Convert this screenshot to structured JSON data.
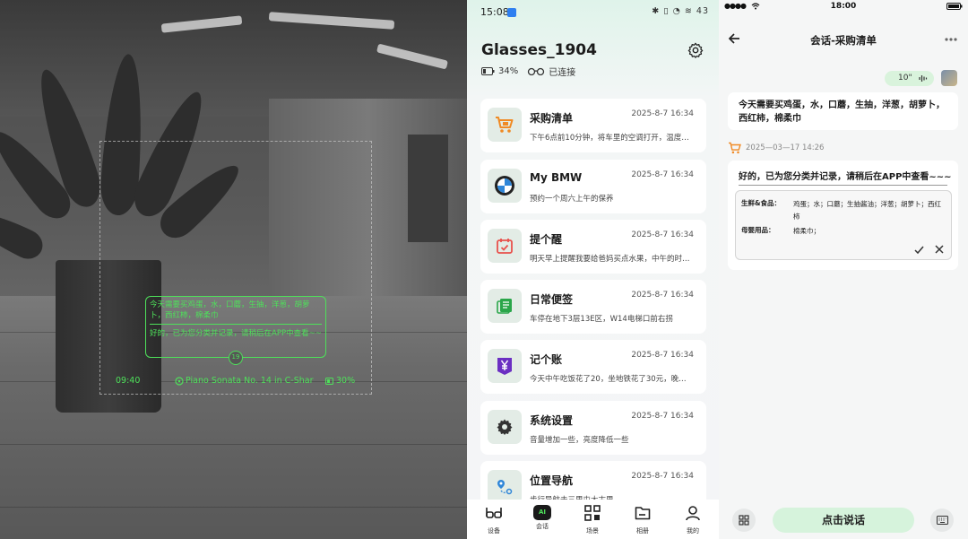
{
  "ar_view": {
    "hud_user_text": "今天需要买鸡蛋，水，口蘑，生抽，洋葱，胡萝卜，西红柿，棉柔巾",
    "hud_reply_text": "好的，已为您分类并记录，请稍后在APP中查看~~",
    "hud_badge": "19",
    "time": "09:40",
    "music": "Piano Sonata No. 14 in C-Shar",
    "battery": "30%"
  },
  "home": {
    "status_time": "15:08",
    "status_icons": "✱ ▯ ◔ ≋ 43",
    "device_name": "Glasses_1904",
    "battery": "34%",
    "connection": "已连接",
    "cards": [
      {
        "name": "采购清单",
        "date": "2025-8-7 16:34",
        "preview": "下午6点前10分钟，将车里的空调打开，温度…",
        "icon": "shopping-cart-icon"
      },
      {
        "name": "My BMW",
        "date": "2025-8-7 16:34",
        "preview": "预约一个周六上午的保养",
        "icon": "bmw-logo-icon"
      },
      {
        "name": "提个醒",
        "date": "2025-8-7 16:34",
        "preview": "明天早上提醒我要给爸妈买点水果，中午的时…",
        "icon": "calendar-icon"
      },
      {
        "name": "日常便签",
        "date": "2025-8-7 16:34",
        "preview": "车停在地下3层13E区，W14电梯口前右拐",
        "icon": "notes-icon"
      },
      {
        "name": "记个账",
        "date": "2025-8-7 16:34",
        "preview": "今天中午吃饭花了20，坐地铁花了30元，晚…",
        "icon": "yen-icon"
      },
      {
        "name": "系统设置",
        "date": "2025-8-7 16:34",
        "preview": "音量增加一些，亮度降低一些",
        "icon": "gear-icon"
      },
      {
        "name": "位置导航",
        "date": "2025-8-7 16:34",
        "preview": "步行导航去三里屯太古里",
        "icon": "map-pin-icon"
      }
    ],
    "tabs": [
      {
        "label": "设备",
        "icon": "glasses-icon"
      },
      {
        "label": "会话",
        "icon": "ai-chat-icon"
      },
      {
        "label": "场景",
        "icon": "grid-icon"
      },
      {
        "label": "相册",
        "icon": "folder-icon"
      },
      {
        "label": "我的",
        "icon": "person-icon"
      }
    ],
    "ai_badge": "AI"
  },
  "chat": {
    "status_time": "18:00",
    "title": "会话-采购清单",
    "voice_duration": "10\"",
    "user_message": "今天需要买鸡蛋，水，口蘑，生抽，洋葱，胡萝卜，西红柿，棉柔巾",
    "system_time": "2025—03—17  14:26",
    "reply": "好的，已为您分类并记录，请稍后在APP中查看~~~",
    "list": [
      {
        "category": "生鲜&食品：",
        "items": "鸡蛋；水；口蘑；生抽酱油；洋葱；胡萝卜；西红柿"
      },
      {
        "category": "母婴用品：",
        "items": "棉柔巾；"
      }
    ],
    "talk_button": "点击说话"
  },
  "colors": {
    "hud_green": "#4ee05a",
    "accent_green": "#d6f3dc",
    "cart_orange": "#f08a24"
  }
}
